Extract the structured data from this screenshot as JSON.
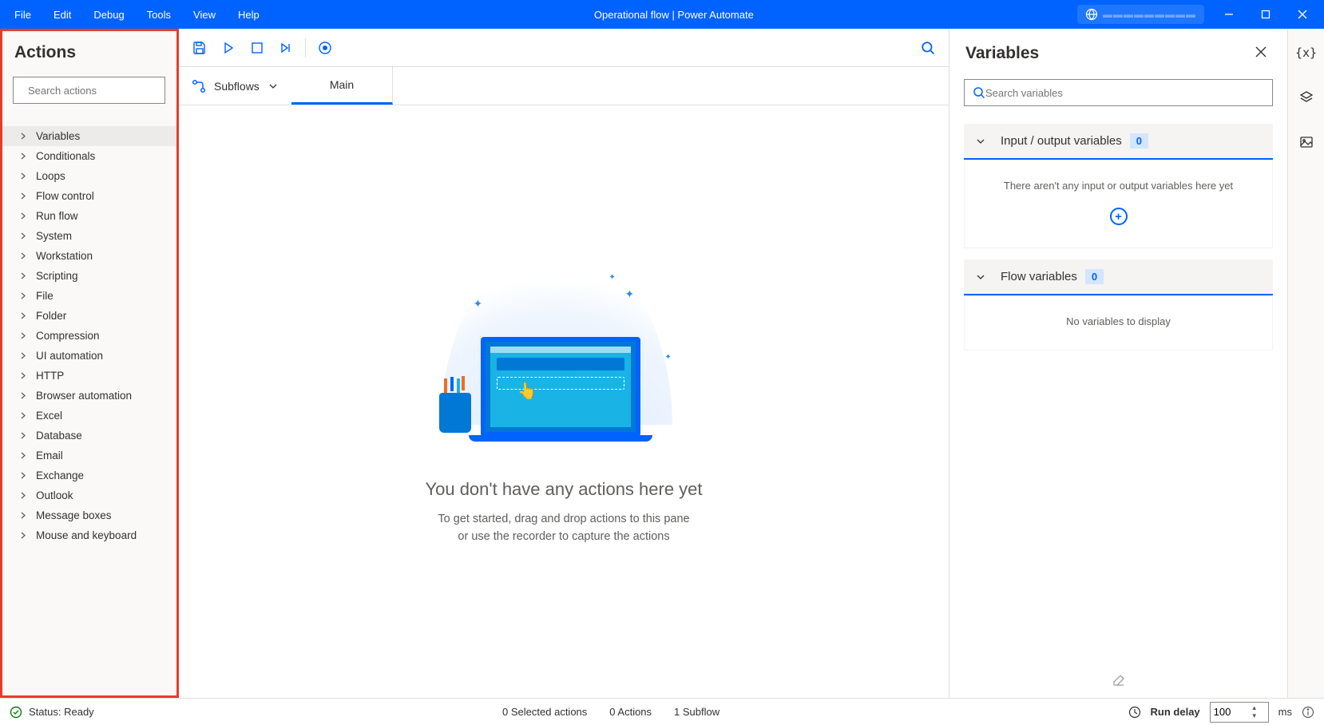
{
  "titlebar": {
    "menus": [
      "File",
      "Edit",
      "Debug",
      "Tools",
      "View",
      "Help"
    ],
    "title": "Operational flow | Power Automate"
  },
  "actions": {
    "title": "Actions",
    "search_placeholder": "Search actions",
    "categories": [
      "Variables",
      "Conditionals",
      "Loops",
      "Flow control",
      "Run flow",
      "System",
      "Workstation",
      "Scripting",
      "File",
      "Folder",
      "Compression",
      "UI automation",
      "HTTP",
      "Browser automation",
      "Excel",
      "Database",
      "Email",
      "Exchange",
      "Outlook",
      "Message boxes",
      "Mouse and keyboard"
    ]
  },
  "editor": {
    "subflows_label": "Subflows",
    "tab_main": "Main",
    "empty_title": "You don't have any actions here yet",
    "empty_sub_line1": "To get started, drag and drop actions to this pane",
    "empty_sub_line2": "or use the recorder to capture the actions"
  },
  "variables": {
    "title": "Variables",
    "search_placeholder": "Search variables",
    "io_section": "Input / output variables",
    "io_count": "0",
    "io_empty": "There aren't any input or output variables here yet",
    "flow_section": "Flow variables",
    "flow_count": "0",
    "flow_empty": "No variables to display"
  },
  "statusbar": {
    "status_label": "Status:",
    "status_value": "Ready",
    "selected": "0 Selected actions",
    "actions_count": "0 Actions",
    "subflows_count": "1 Subflow",
    "run_delay_label": "Run delay",
    "run_delay_value": "100",
    "run_delay_unit": "ms"
  }
}
